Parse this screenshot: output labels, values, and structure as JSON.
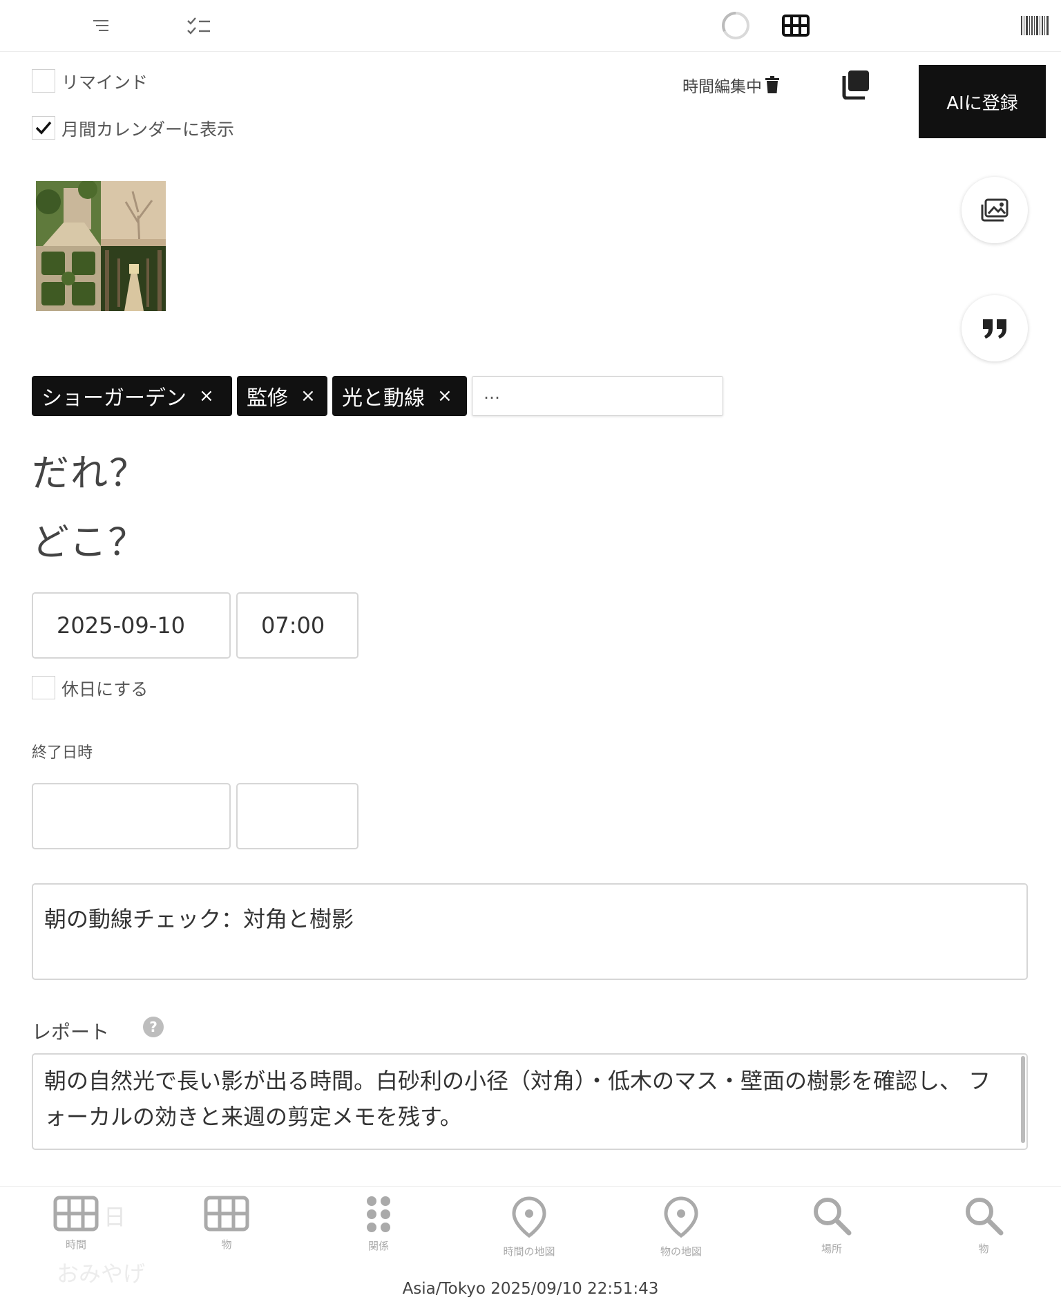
{
  "reminder": {
    "label": "リマインド",
    "checked": false
  },
  "monthly_calendar": {
    "label": "月間カレンダーに表示",
    "checked": true
  },
  "editing_status": "時間編集中",
  "ai_register_label": "AIに登録",
  "tags": [
    {
      "label": "ショーガーデン"
    },
    {
      "label": "監修"
    },
    {
      "label": "光と動線"
    }
  ],
  "tag_remove_glyph": "×",
  "tag_input_placeholder": "…",
  "who_label": "だれ？",
  "where_label": "どこ？",
  "start": {
    "date": "2025-09-10",
    "time": "07:00"
  },
  "holiday": {
    "label": "休日にする",
    "checked": false
  },
  "end_label": "終了日時",
  "end": {
    "date": "",
    "time": ""
  },
  "title_value": "朝の動線チェック：対角と樹影",
  "report_label": "レポート",
  "report_value": "朝の自然光で長い影が出る時間。白砂利の小径（対角）・低木のマス・壁面の樹影を確認し、 フォーカルの効きと来週の剪定メモを残す。",
  "bottom_nav": [
    {
      "label": "時間",
      "icon": "grid-icon"
    },
    {
      "label": "物",
      "icon": "grid-icon"
    },
    {
      "label": "関係",
      "icon": "dots-grid-icon"
    },
    {
      "label": "時間の地図",
      "icon": "map-pin-icon"
    },
    {
      "label": "物の地図",
      "icon": "map-pin-icon"
    },
    {
      "label": "場所",
      "icon": "search-icon"
    },
    {
      "label": "物",
      "icon": "search-icon"
    }
  ],
  "ghost_text": {
    "day": "日",
    "souvenir": "おみやげ"
  },
  "footer_timezone_time": "Asia/Tokyo 2025/09/10 22:51:43"
}
